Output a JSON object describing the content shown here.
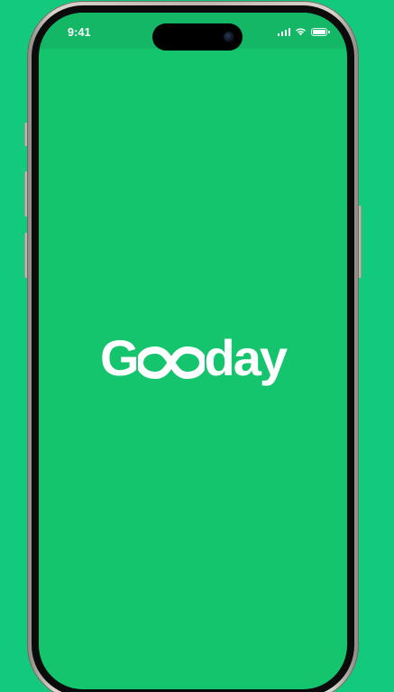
{
  "status_bar": {
    "time": "9:41",
    "icons": [
      "signal-icon",
      "wifi-icon",
      "battery-icon"
    ]
  },
  "splash": {
    "logo_prefix": "G",
    "logo_mark": "infinity-icon",
    "logo_suffix": "day"
  },
  "colors": {
    "background": "#12C97E",
    "screen": "#14C56E",
    "logo": "#FFFFFF"
  }
}
